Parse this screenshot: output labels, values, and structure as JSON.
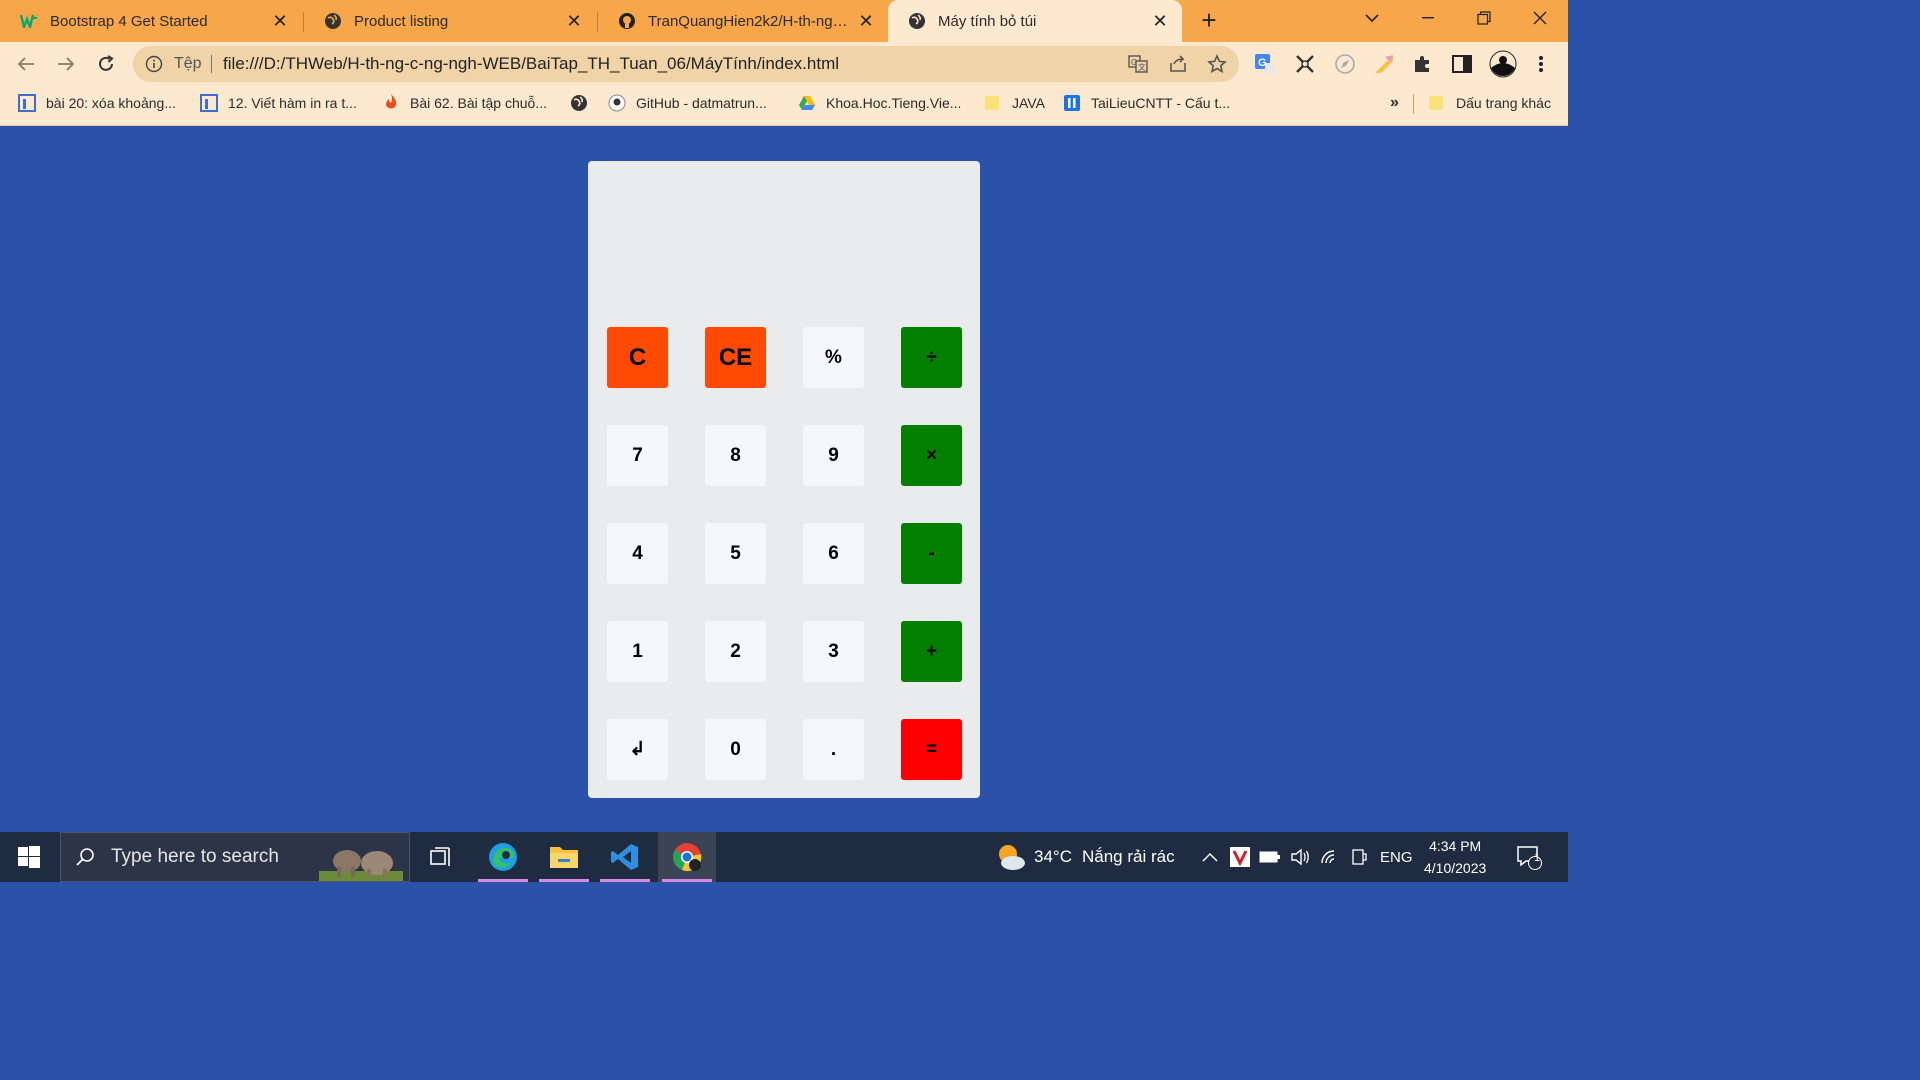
{
  "browser": {
    "tabs": [
      {
        "title": "Bootstrap 4 Get Started",
        "icon": "w3schools-icon",
        "active": false
      },
      {
        "title": "Product listing",
        "icon": "globe-icon",
        "active": false
      },
      {
        "title": "TranQuangHien2k2/H-th-ng-c-ng",
        "icon": "github-icon",
        "active": false
      },
      {
        "title": "Máy tính bỏ túi",
        "icon": "globe-icon",
        "active": true
      }
    ],
    "omnibox": {
      "scheme_label": "Tệp",
      "url": "file:///D:/THWeb/H-th-ng-c-ng-ngh-WEB/BaiTap_TH_Tuan_06/MáyTính/index.html"
    },
    "bookmarks": [
      {
        "label": "bài 20: xóa khoảng...",
        "icon": "page-icon"
      },
      {
        "label": "12. Viết hàm in ra t...",
        "icon": "page-icon"
      },
      {
        "label": "Bài 62. Bài tập chuỗ...",
        "icon": "fire-icon"
      },
      {
        "label": "",
        "icon": "globe-icon"
      },
      {
        "label": "GitHub - datmatrun...",
        "icon": "github-icon"
      },
      {
        "label": "Khoa.Hoc.Tieng.Vie...",
        "icon": "drive-icon"
      },
      {
        "label": "JAVA",
        "icon": "folder-icon"
      },
      {
        "label": "TaiLieuCNTT - Cấu t...",
        "icon": "tailieu-icon"
      }
    ],
    "bookmarks_overflow": "»",
    "other_bookmarks": "Dấu trang khác"
  },
  "calculator": {
    "display": "",
    "keys": [
      {
        "label": "C",
        "name": "clear-button",
        "style": "orange big"
      },
      {
        "label": "CE",
        "name": "clear-entry-button",
        "style": "orange big"
      },
      {
        "label": "%",
        "name": "percent-button",
        "style": "light"
      },
      {
        "label": "÷",
        "name": "divide-button",
        "style": "green"
      },
      {
        "label": "7",
        "name": "digit-7-button",
        "style": "light"
      },
      {
        "label": "8",
        "name": "digit-8-button",
        "style": "light"
      },
      {
        "label": "9",
        "name": "digit-9-button",
        "style": "light"
      },
      {
        "label": "×",
        "name": "multiply-button",
        "style": "green"
      },
      {
        "label": "4",
        "name": "digit-4-button",
        "style": "light"
      },
      {
        "label": "5",
        "name": "digit-5-button",
        "style": "light"
      },
      {
        "label": "6",
        "name": "digit-6-button",
        "style": "light"
      },
      {
        "label": "-",
        "name": "subtract-button",
        "style": "green"
      },
      {
        "label": "1",
        "name": "digit-1-button",
        "style": "light"
      },
      {
        "label": "2",
        "name": "digit-2-button",
        "style": "light"
      },
      {
        "label": "3",
        "name": "digit-3-button",
        "style": "light"
      },
      {
        "label": "+",
        "name": "add-button",
        "style": "green"
      },
      {
        "label": "↲",
        "name": "backspace-button",
        "style": "light"
      },
      {
        "label": "0",
        "name": "digit-0-button",
        "style": "light"
      },
      {
        "label": ".",
        "name": "decimal-button",
        "style": "light"
      },
      {
        "label": "=",
        "name": "equals-button",
        "style": "red"
      }
    ]
  },
  "taskbar": {
    "search_placeholder": "Type here to search",
    "weather": {
      "temp": "34°C",
      "desc": "Nắng rải rác"
    },
    "language": "ENG",
    "time": "4:34 PM",
    "date": "4/10/2023",
    "notification_count": "1"
  },
  "colors": {
    "page_background": "#2a52a8",
    "calculator_body": "#e9ebed",
    "operator_green": "#038001",
    "clear_orange": "#ff4a04",
    "equals_red": "#fe0000",
    "browser_chrome": "#f7a64a"
  }
}
